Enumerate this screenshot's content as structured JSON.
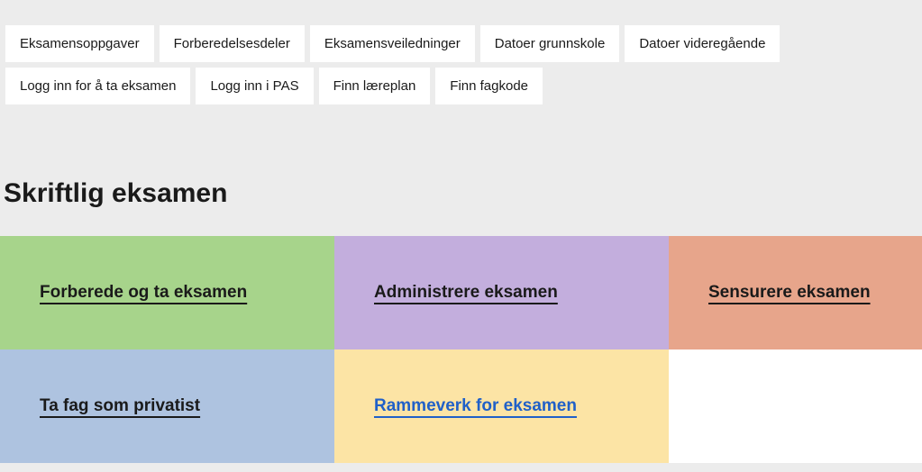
{
  "chips": [
    {
      "id": "eksamensoppgaver",
      "label": "Eksamensoppgaver"
    },
    {
      "id": "forberedelsesdeler",
      "label": "Forberedelsesdeler"
    },
    {
      "id": "eksamensveiledninger",
      "label": "Eksamensveiledninger"
    },
    {
      "id": "datoer-grunnskole",
      "label": "Datoer grunnskole"
    },
    {
      "id": "datoer-videregaende",
      "label": "Datoer videregående"
    },
    {
      "id": "logg-inn-eksamen",
      "label": "Logg inn for å ta eksamen"
    },
    {
      "id": "logg-inn-pas",
      "label": "Logg inn i PAS"
    },
    {
      "id": "finn-laereplan",
      "label": "Finn læreplan"
    },
    {
      "id": "finn-fagkode",
      "label": "Finn fagkode"
    }
  ],
  "page_title": "Skriftlig eksamen",
  "tiles": [
    {
      "id": "forberede",
      "label": "Forberede og ta eksamen",
      "color": "green"
    },
    {
      "id": "administrere",
      "label": "Administrere eksamen",
      "color": "purple"
    },
    {
      "id": "sensurere",
      "label": "Sensurere eksamen",
      "color": "salmon"
    },
    {
      "id": "privatist",
      "label": "Ta fag som privatist",
      "color": "blue"
    },
    {
      "id": "rammeverk",
      "label": "Rammeverk for eksamen",
      "color": "yellow"
    }
  ]
}
